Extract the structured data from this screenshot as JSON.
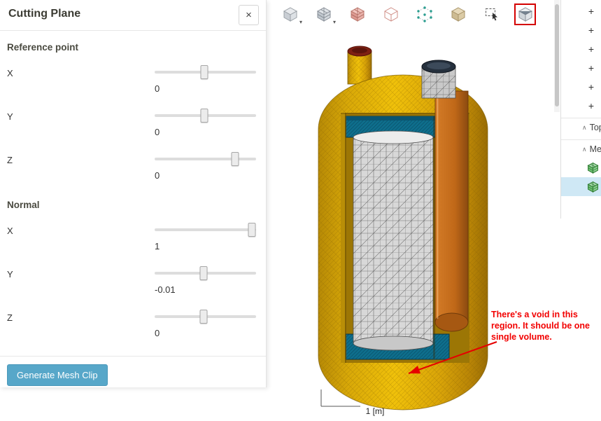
{
  "panel": {
    "title": "Cutting Plane",
    "close_label": "×",
    "sections": [
      {
        "heading": "Reference point",
        "sliders": [
          {
            "label": "X",
            "value": "0",
            "pos": 49
          },
          {
            "label": "Y",
            "value": "0",
            "pos": 49
          },
          {
            "label": "Z",
            "value": "0",
            "pos": 79
          }
        ]
      },
      {
        "heading": "Normal",
        "sliders": [
          {
            "label": "X",
            "value": "1",
            "pos": 96
          },
          {
            "label": "Y",
            "value": "-0.01",
            "pos": 48
          },
          {
            "label": "Z",
            "value": "0",
            "pos": 48
          }
        ]
      }
    ],
    "generate_button_label": "Generate Mesh Clip"
  },
  "toolbar": {
    "caret_glyph": "▾",
    "icons": [
      {
        "name": "surface-view-icon",
        "caret": true
      },
      {
        "name": "surface-with-edges-icon",
        "caret": true
      },
      {
        "name": "mesh-quality-icon",
        "caret": false
      },
      {
        "name": "wireframe-icon",
        "caret": false
      },
      {
        "name": "points-view-icon",
        "caret": false
      },
      {
        "name": "volume-view-icon",
        "caret": false
      },
      {
        "name": "box-select-icon",
        "caret": false
      },
      {
        "name": "mesh-clip-icon",
        "caret": false,
        "highlighted": true
      }
    ]
  },
  "viewport": {
    "scale_label": "1 [m]",
    "annotation_text": "There's a void in this region. It should be one single volume."
  },
  "right_panel": {
    "expander_label": "+",
    "collapse_label": "∧",
    "sections": [
      {
        "label": "Top"
      },
      {
        "label": "Me"
      }
    ]
  }
}
